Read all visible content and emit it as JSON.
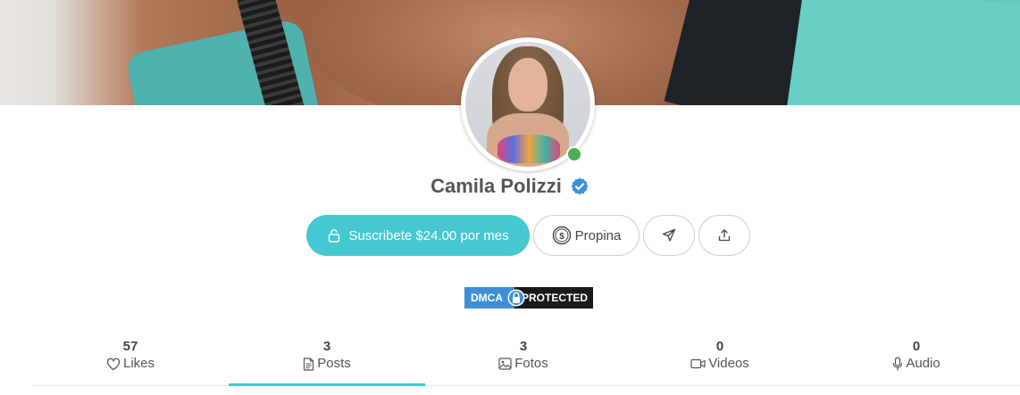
{
  "profile": {
    "name": "Camila Polizzi",
    "verified": true,
    "online": true
  },
  "actions": {
    "subscribe_label": "Suscribete $24.00 por mes",
    "tip_label": "Propina",
    "message_icon": "send-icon",
    "share_icon": "share-icon"
  },
  "badge": {
    "left": "DMCA",
    "right": "PROTECTED"
  },
  "tabs": [
    {
      "count": "57",
      "label": "Likes",
      "icon": "heart-icon",
      "active": false
    },
    {
      "count": "3",
      "label": "Posts",
      "icon": "document-icon",
      "active": true
    },
    {
      "count": "3",
      "label": "Fotos",
      "icon": "image-icon",
      "active": false
    },
    {
      "count": "0",
      "label": "Videos",
      "icon": "video-icon",
      "active": false
    },
    {
      "count": "0",
      "label": "Audio",
      "icon": "microphone-icon",
      "active": false
    }
  ],
  "colors": {
    "accent": "#45c8d0",
    "verified": "#3d8fd8",
    "online": "#4caf50"
  }
}
